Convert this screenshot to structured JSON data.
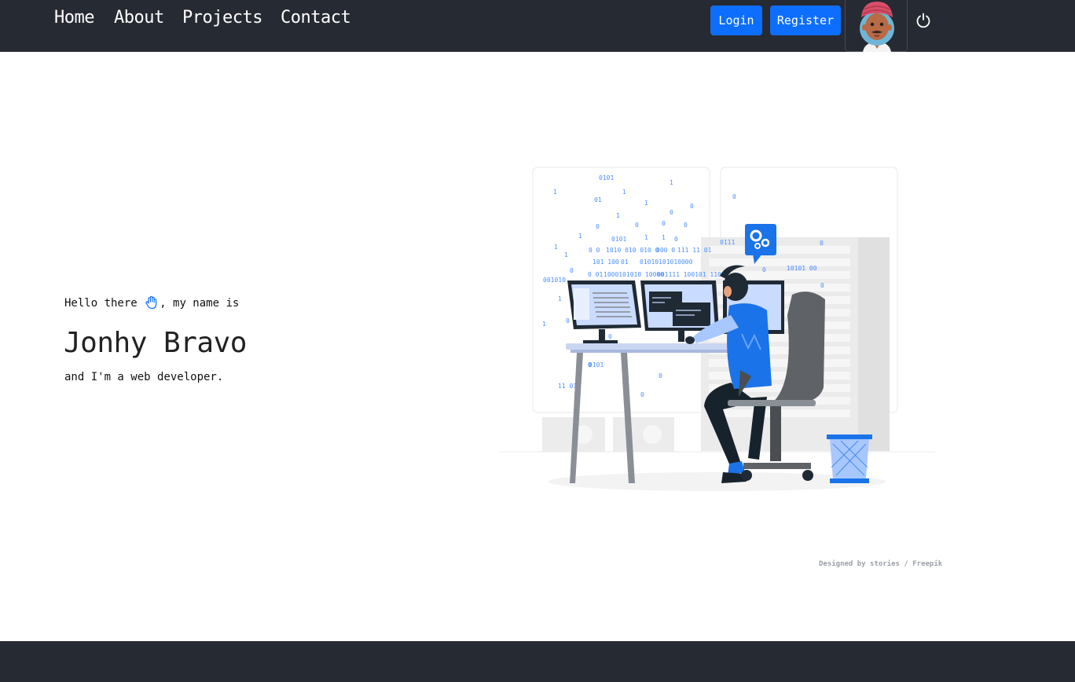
{
  "nav": {
    "links": [
      "Home",
      "About",
      "Projects",
      "Contact"
    ],
    "login_label": "Login",
    "register_label": "Register",
    "avatar_icon": "avatar-icon",
    "power_icon": "power-icon"
  },
  "hero": {
    "greeting_before": "Hello there ",
    "greeting_after": ", my name is",
    "wave_icon": "hand-wave-icon",
    "name": "Jonhy Bravo",
    "tagline": "and I'm a web developer."
  },
  "illustration": {
    "credit_prefix": "Designed by ",
    "credit_stories": "stories",
    "credit_sep": " / ",
    "credit_freepik": "Freepik",
    "binary": [
      "0101",
      "1",
      "1",
      "01",
      "1",
      "1",
      "0",
      "1",
      "0",
      "0",
      "0",
      "0",
      "1",
      "0",
      "0101",
      "1",
      "1",
      "1",
      "0",
      "1",
      "0 0",
      "1010 010 010 0",
      "000 0",
      "111 11 01",
      "101 100",
      "01",
      "01010101010000",
      "0 01",
      "1000101010 10000",
      "001111 100101 110",
      "001010",
      "0",
      "1",
      "0",
      "0",
      "0",
      "0101",
      "0",
      "11 01",
      "0111",
      "0",
      "0",
      "10101 00",
      "0",
      "0",
      "1",
      "0"
    ]
  },
  "colors": {
    "navbar_bg": "#262a33",
    "accent": "#0d6efd",
    "illustration_blue": "#1a73e8"
  }
}
